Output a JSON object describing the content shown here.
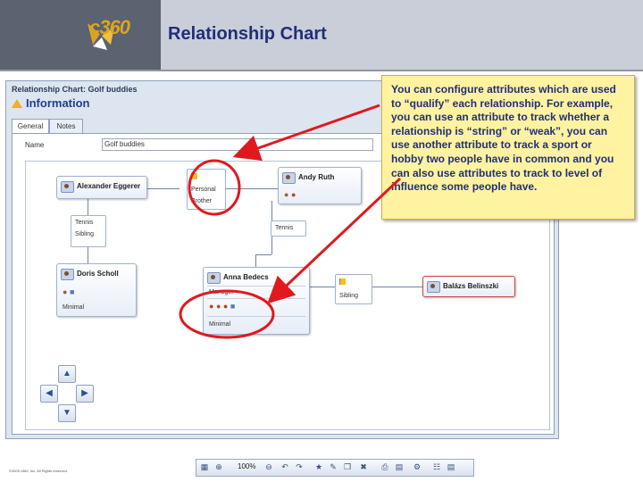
{
  "slide": {
    "logo_text": "c360",
    "title": "Relationship Chart",
    "footer": "©2009 c360, Inc. All Rights reserved."
  },
  "app": {
    "window_title": "Relationship Chart: Golf buddies",
    "section_title": "Information",
    "tabs": [
      {
        "label": "General",
        "active": true
      },
      {
        "label": "Notes",
        "active": false
      }
    ],
    "name_label": "Name",
    "name_value": "Golf buddies"
  },
  "people": [
    {
      "name": "Alexander Eggerer",
      "roles": ""
    },
    {
      "name": "Andy Ruth",
      "roles": ""
    },
    {
      "name": "Doris Scholl",
      "detail": "Minimal"
    },
    {
      "name": "Anna Bedecs",
      "top": "Manager",
      "bottom": "Minimal"
    },
    {
      "name": "Balázs Belinszki"
    }
  ],
  "relations": [
    {
      "line1": "Personal",
      "line2": "Brother"
    },
    {
      "line1": "Tennis",
      "line2": "Sibling"
    },
    {
      "line1": "Tennis"
    },
    {
      "line1": "Sibling"
    }
  ],
  "toolbar": {
    "zoom": "100%"
  },
  "callout": {
    "text": "You can configure attributes which are used to “qualify” each relationship. For example, you can use an attribute to track whether a relationship is “string” or “weak”, you can use another attribute to track a sport or hobby two people have in common and you can also use attributes to track to level of influence some people have."
  },
  "colors": {
    "header_bg": "#c9ced8",
    "title_color": "#1f2f7a",
    "callout_bg": "#fff2a0",
    "highlight_red": "#e0191e",
    "accent_gold": "#d9a520"
  }
}
